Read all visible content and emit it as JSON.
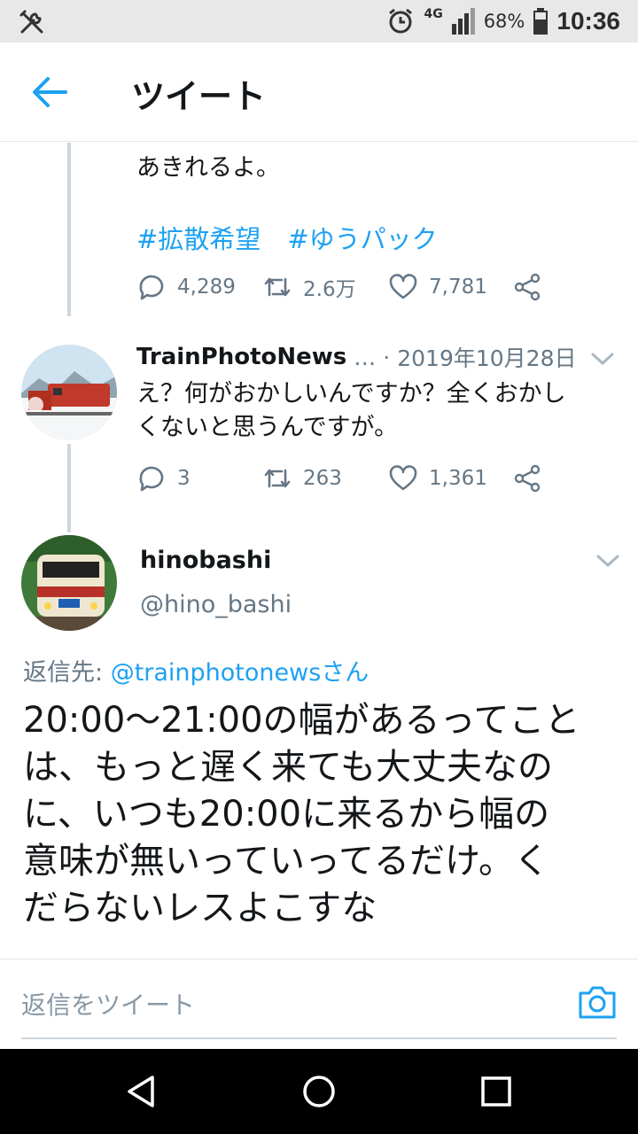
{
  "status_bar": {
    "network": "4G",
    "battery": "68%",
    "time": "10:36"
  },
  "header": {
    "title": "ツイート"
  },
  "prev_tweet": {
    "text_tail": "あきれるよ。",
    "hashtags": [
      "#拡散希望",
      "#ゆうパック"
    ],
    "replies": "4,289",
    "retweets": "2.6万",
    "likes": "7,781"
  },
  "reply_tweet": {
    "name": "TrainPhotoNews",
    "ellipsis": "…",
    "dot": "·",
    "date": "2019年10月28日",
    "text_line1": "え？何がおかしいんですか？全くおかし",
    "text_line2": "くないと思うんですが。",
    "replies": "3",
    "retweets": "263",
    "likes": "1,361"
  },
  "main_tweet": {
    "name": "hinobashi",
    "handle": "@hino_bashi",
    "reply_to_label": "返信先: ",
    "reply_to_user": "@trainphotonewsさん",
    "lines": [
      "20:00〜21:00の幅があるってこと",
      "は、もっと遅く来ても大丈夫なの",
      "に、いつも20:00に来るから幅の",
      "意味が無いっていってるだけ。く",
      "だらないレスよこすな"
    ]
  },
  "reply_bar": {
    "placeholder": "返信をツイート"
  },
  "colors": {
    "accent": "#1da1f2",
    "muted": "#657786"
  }
}
